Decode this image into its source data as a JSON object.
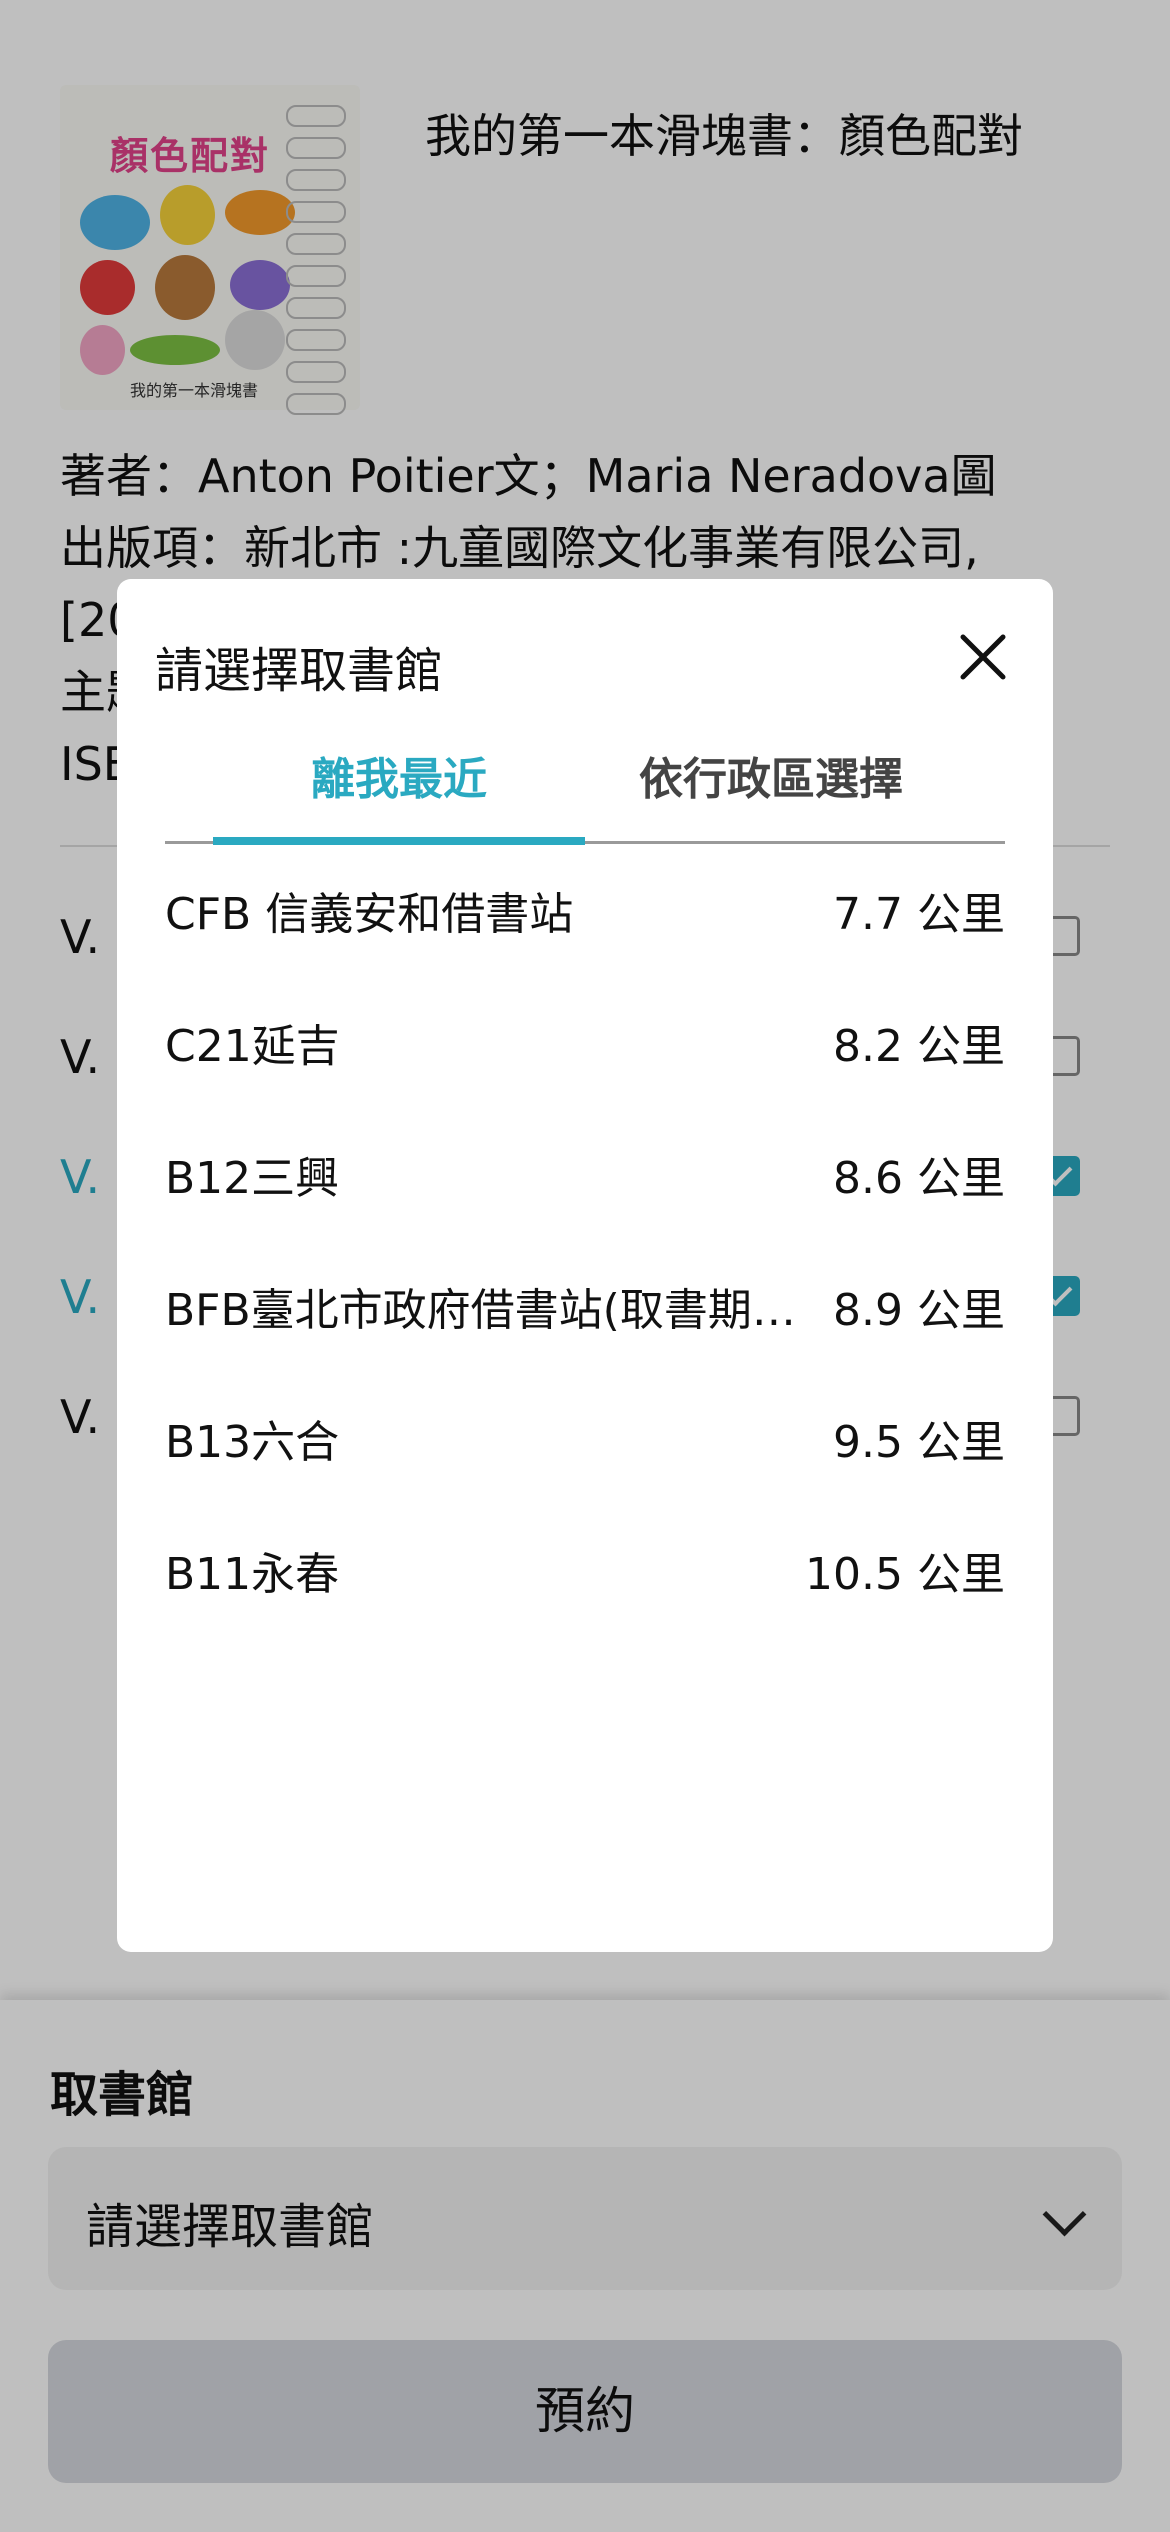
{
  "book": {
    "cover_title": "顏色配對",
    "cover_subtitle": "我的第一本滑塊書",
    "title": "我的第一本滑塊書：顏色配對",
    "author_line": "著者：Anton Poitier文；Maria Neradova圖",
    "publisher_line": "出版項：新北市 :九童國際文化事業有限公司,",
    "year_line": "[20",
    "subject_line": "主題",
    "isbn_line": "ISB"
  },
  "volumes": [
    {
      "label": "V.",
      "selected": false
    },
    {
      "label": "V.",
      "selected": false
    },
    {
      "label": "V.",
      "selected": true
    },
    {
      "label": "V.",
      "selected": true
    },
    {
      "label": "V.",
      "selected": false
    }
  ],
  "pickup": {
    "label": "取書館",
    "placeholder": "請選擇取書館",
    "reserve_label": "預約"
  },
  "modal": {
    "title": "請選擇取書館",
    "tabs": [
      {
        "label": "離我最近",
        "active": true
      },
      {
        "label": "依行政區選擇",
        "active": false
      }
    ],
    "branches": [
      {
        "name": "CFB 信義安和借書站",
        "distance": "7.7 公里"
      },
      {
        "name": "C21延吉",
        "distance": "8.2 公里"
      },
      {
        "name": "B12三興",
        "distance": "8.6 公里"
      },
      {
        "name": "BFB臺北市政府借書站(取書期限...",
        "distance": "8.9 公里"
      },
      {
        "name": "B13六合",
        "distance": "9.5 公里"
      },
      {
        "name": "B11永春",
        "distance": "10.5 公里"
      }
    ]
  },
  "colors": {
    "accent": "#2aa9c1",
    "overlay": "rgba(0,0,0,0.25)"
  }
}
